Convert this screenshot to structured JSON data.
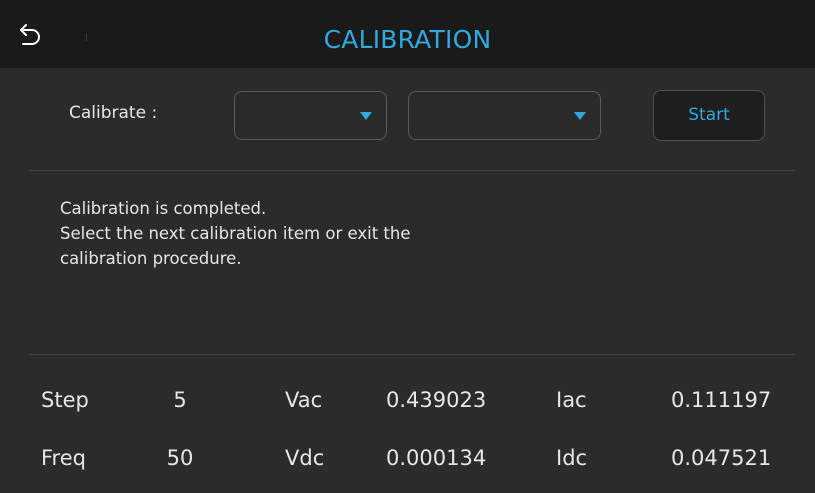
{
  "header": {
    "title": "CALIBRATION",
    "back_icon": "back-arrow-icon"
  },
  "calibrate": {
    "label": "Calibrate :",
    "dropdown1_value": "",
    "dropdown2_value": "",
    "start_label": "Start"
  },
  "message": {
    "lines": [
      "Calibration is completed.",
      "Select the next calibration item or exit the",
      "calibration procedure."
    ]
  },
  "readings": {
    "row1": [
      {
        "label": "Step",
        "value": "5"
      },
      {
        "label": "Vac",
        "value": "0.439023"
      },
      {
        "label": "Iac",
        "value": "0.111197"
      }
    ],
    "row2": [
      {
        "label": "Freq",
        "value": "50"
      },
      {
        "label": "Vdc",
        "value": "0.000134"
      },
      {
        "label": "Idc",
        "value": "0.047521"
      }
    ]
  },
  "colors": {
    "accent": "#2fa9df",
    "header_bg": "#1a1a1a",
    "body_bg": "#2b2b2b",
    "text": "#e6e6e6"
  }
}
